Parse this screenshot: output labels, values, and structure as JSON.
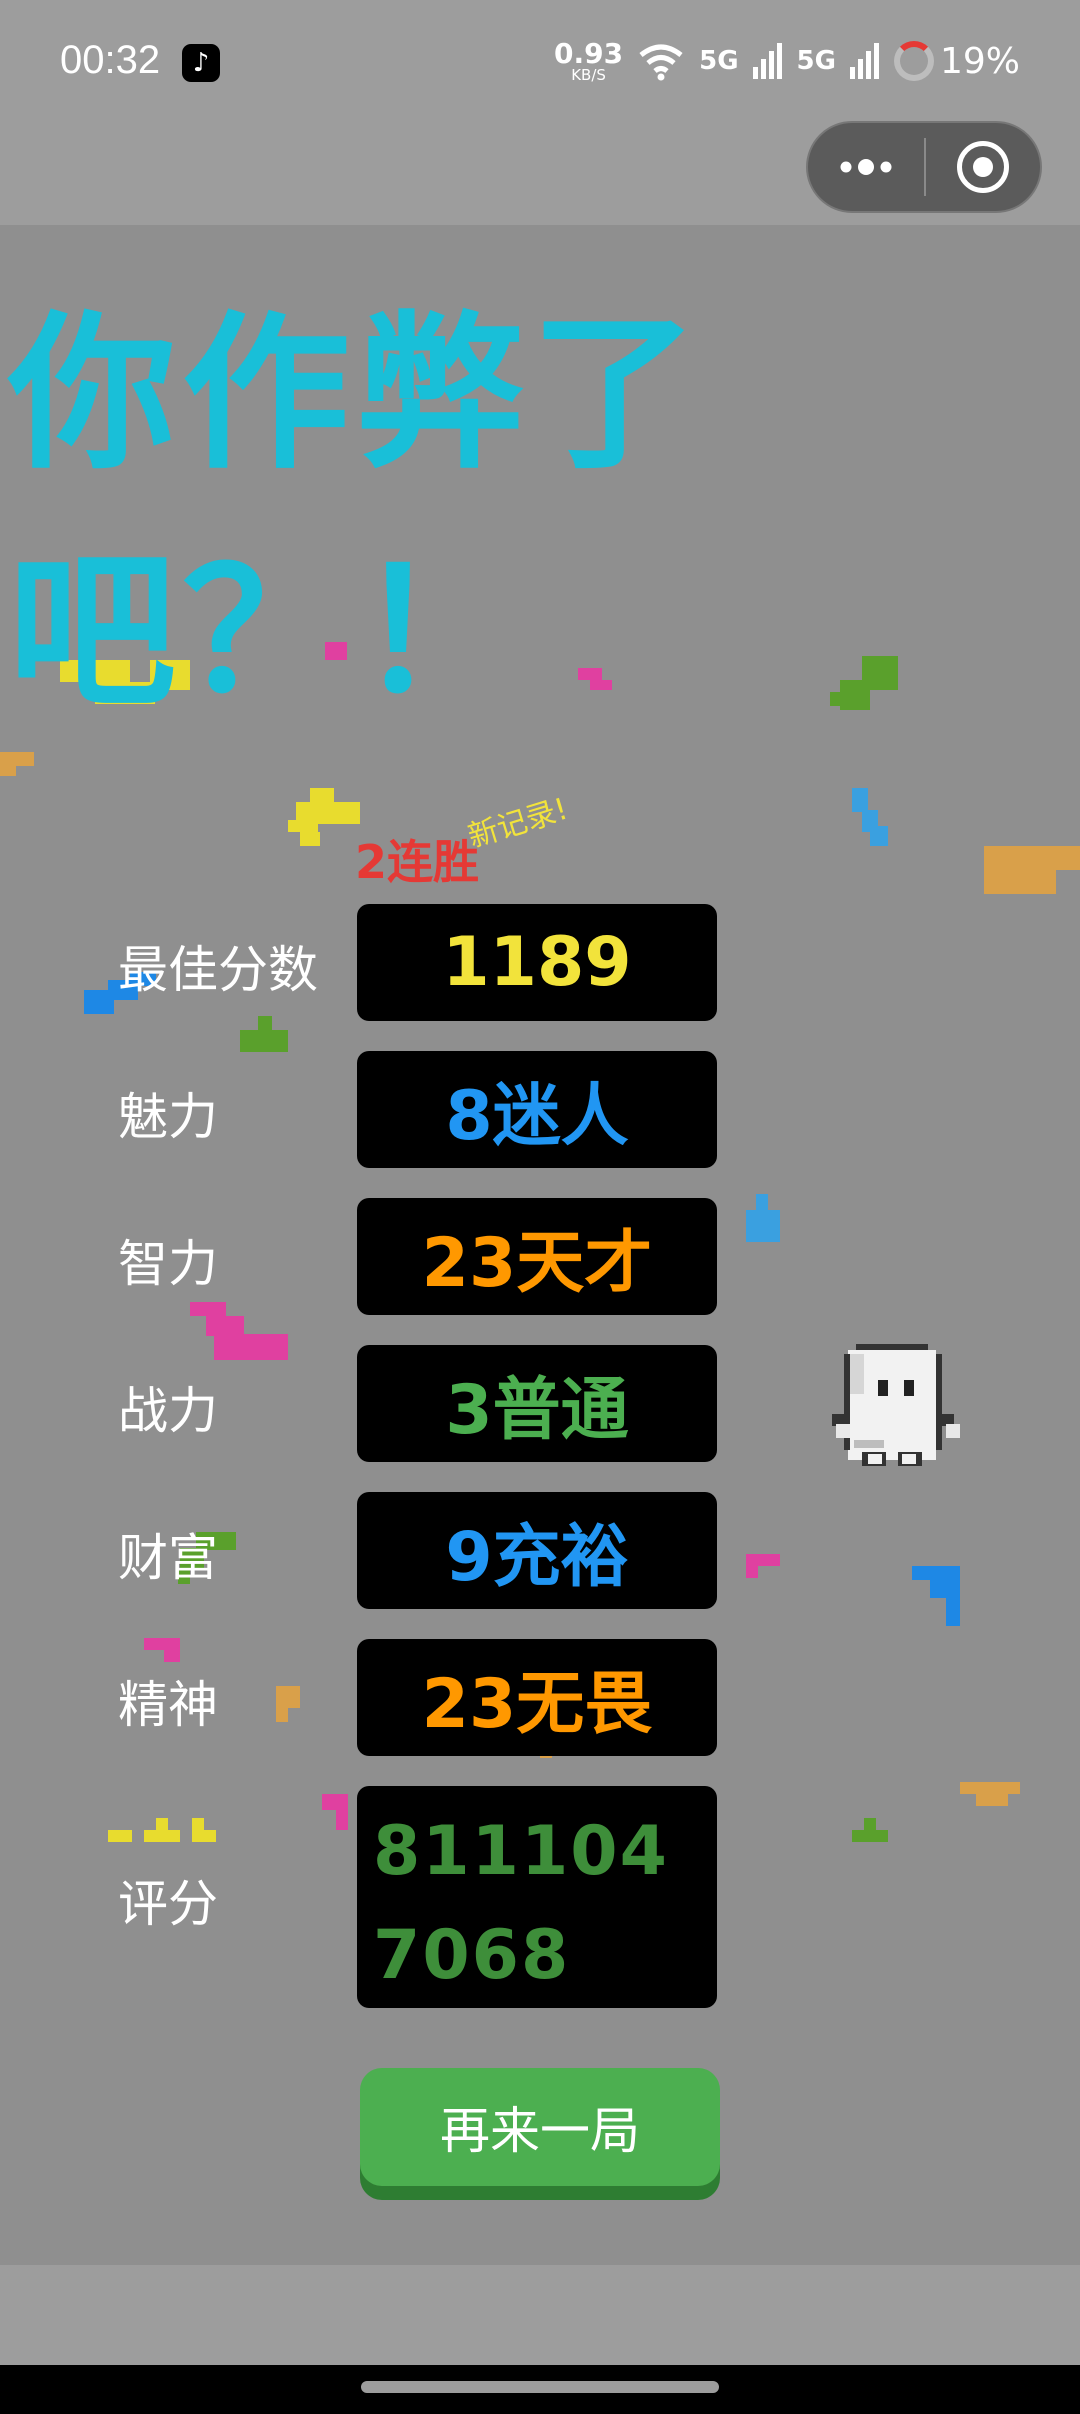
{
  "status_bar": {
    "time": "00:32",
    "net_speed_value": "0.93",
    "net_speed_unit": "KB/S",
    "signal1": "5G",
    "signal2": "5G",
    "battery_percent": "19%",
    "app_icon": "tiktok-icon"
  },
  "capsule": {
    "more_label": "•••",
    "close_icon": "target-circle-icon"
  },
  "headline": {
    "line1": "你作弊了",
    "line2": "吧？！"
  },
  "badges": {
    "new_record": "新记录!",
    "streak": "2连胜"
  },
  "stats": [
    {
      "label": "最佳分数",
      "value": "1189",
      "color": "#f2e33b"
    },
    {
      "label": "魅力",
      "value": "8迷人",
      "color": "#2196f3"
    },
    {
      "label": "智力",
      "value": "23天才",
      "color": "#ff9800"
    },
    {
      "label": "战力",
      "value": "3普通",
      "color": "#4caf50"
    },
    {
      "label": "财富",
      "value": "9充裕",
      "color": "#2196f3"
    },
    {
      "label": "精神",
      "value": "23无畏",
      "color": "#ff9800"
    }
  ],
  "score": {
    "label": "评分",
    "value": "8111047068",
    "color": "#3e8e3a"
  },
  "actions": {
    "play_again": "再来一局"
  }
}
